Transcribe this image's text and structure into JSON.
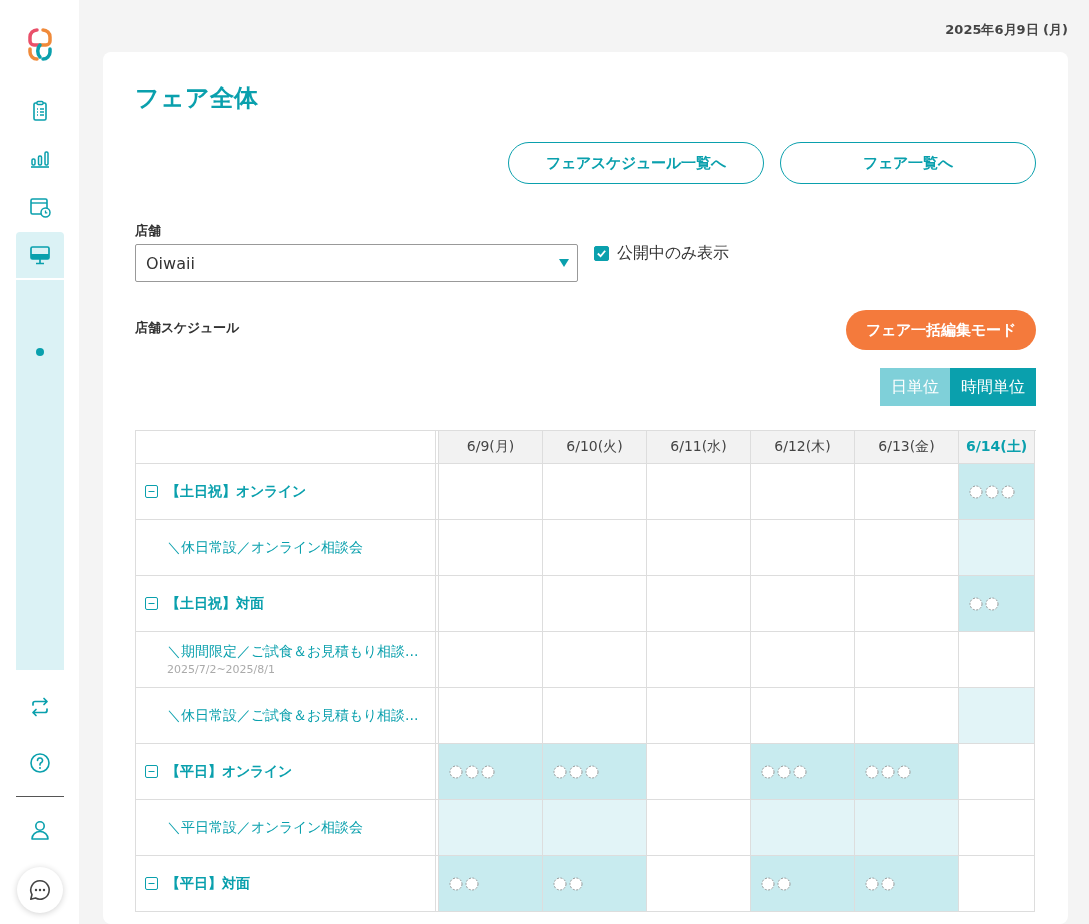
{
  "sidebar": {
    "items": [
      {
        "kind": "clipboard",
        "selected": false
      },
      {
        "kind": "chart",
        "selected": false
      },
      {
        "kind": "calendar",
        "selected": false
      },
      {
        "kind": "monitor",
        "selected": true
      }
    ],
    "bottom_items": [
      {
        "kind": "swap"
      },
      {
        "kind": "help"
      },
      {
        "kind": "user"
      }
    ]
  },
  "date": "2025年6月9日 (月)",
  "title": "フェア全体",
  "nav_buttons": [
    "フェアスケジュール一覧へ",
    "フェア一覧へ"
  ],
  "store": {
    "label": "店舗",
    "value": "Oiwaii"
  },
  "public_only": {
    "label": "公開中のみ表示",
    "checked": true
  },
  "schedule_label": "店舗スケジュール",
  "bulk_edit_button": "フェア一括編集モード",
  "unit_toggle": [
    {
      "label": "日単位",
      "selected": false
    },
    {
      "label": "時間単位",
      "selected": true
    }
  ],
  "table": {
    "columns": [
      {
        "label": "6/9(月)",
        "highlight": false
      },
      {
        "label": "6/10(火)",
        "highlight": false
      },
      {
        "label": "6/11(水)",
        "highlight": false
      },
      {
        "label": "6/12(木)",
        "highlight": false
      },
      {
        "label": "6/13(金)",
        "highlight": false
      },
      {
        "label": "6/14(土)",
        "highlight": true
      }
    ],
    "rows": [
      {
        "kind": "group",
        "label": "【土日祝】オンライン",
        "cells": [
          {
            "kind": "empty"
          },
          {
            "kind": "empty"
          },
          {
            "kind": "empty"
          },
          {
            "kind": "empty"
          },
          {
            "kind": "empty"
          },
          {
            "kind": "three"
          }
        ]
      },
      {
        "kind": "item",
        "label": "＼休日常設／オンライン相談会",
        "cells": [
          {
            "kind": "empty"
          },
          {
            "kind": "empty"
          },
          {
            "kind": "empty"
          },
          {
            "kind": "empty"
          },
          {
            "kind": "empty"
          },
          {
            "kind": "pale"
          }
        ]
      },
      {
        "kind": "group",
        "label": "【土日祝】対面",
        "cells": [
          {
            "kind": "empty"
          },
          {
            "kind": "empty"
          },
          {
            "kind": "empty"
          },
          {
            "kind": "empty"
          },
          {
            "kind": "empty"
          },
          {
            "kind": "two"
          }
        ]
      },
      {
        "kind": "item",
        "label": "＼期間限定／ご試食＆お見積もり相談...",
        "period": "2025/7/2~2025/8/1",
        "cells": [
          {
            "kind": "empty"
          },
          {
            "kind": "empty"
          },
          {
            "kind": "empty"
          },
          {
            "kind": "empty"
          },
          {
            "kind": "empty"
          },
          {
            "kind": "empty"
          }
        ]
      },
      {
        "kind": "item",
        "label": "＼休日常設／ご試食＆お見積もり相談...",
        "cells": [
          {
            "kind": "empty"
          },
          {
            "kind": "empty"
          },
          {
            "kind": "empty"
          },
          {
            "kind": "empty"
          },
          {
            "kind": "empty"
          },
          {
            "kind": "pale"
          }
        ]
      },
      {
        "kind": "group",
        "label": "【平日】オンライン",
        "cells": [
          {
            "kind": "three"
          },
          {
            "kind": "three"
          },
          {
            "kind": "empty"
          },
          {
            "kind": "three"
          },
          {
            "kind": "three"
          },
          {
            "kind": "empty"
          }
        ]
      },
      {
        "kind": "item",
        "label": "＼平日常設／オンライン相談会",
        "cells": [
          {
            "kind": "pale"
          },
          {
            "kind": "pale"
          },
          {
            "kind": "empty"
          },
          {
            "kind": "pale"
          },
          {
            "kind": "pale"
          },
          {
            "kind": "empty"
          }
        ]
      },
      {
        "kind": "group",
        "label": "【平日】対面",
        "cells": [
          {
            "kind": "two"
          },
          {
            "kind": "two"
          },
          {
            "kind": "empty"
          },
          {
            "kind": "two"
          },
          {
            "kind": "two"
          },
          {
            "kind": "empty"
          }
        ]
      }
    ]
  }
}
